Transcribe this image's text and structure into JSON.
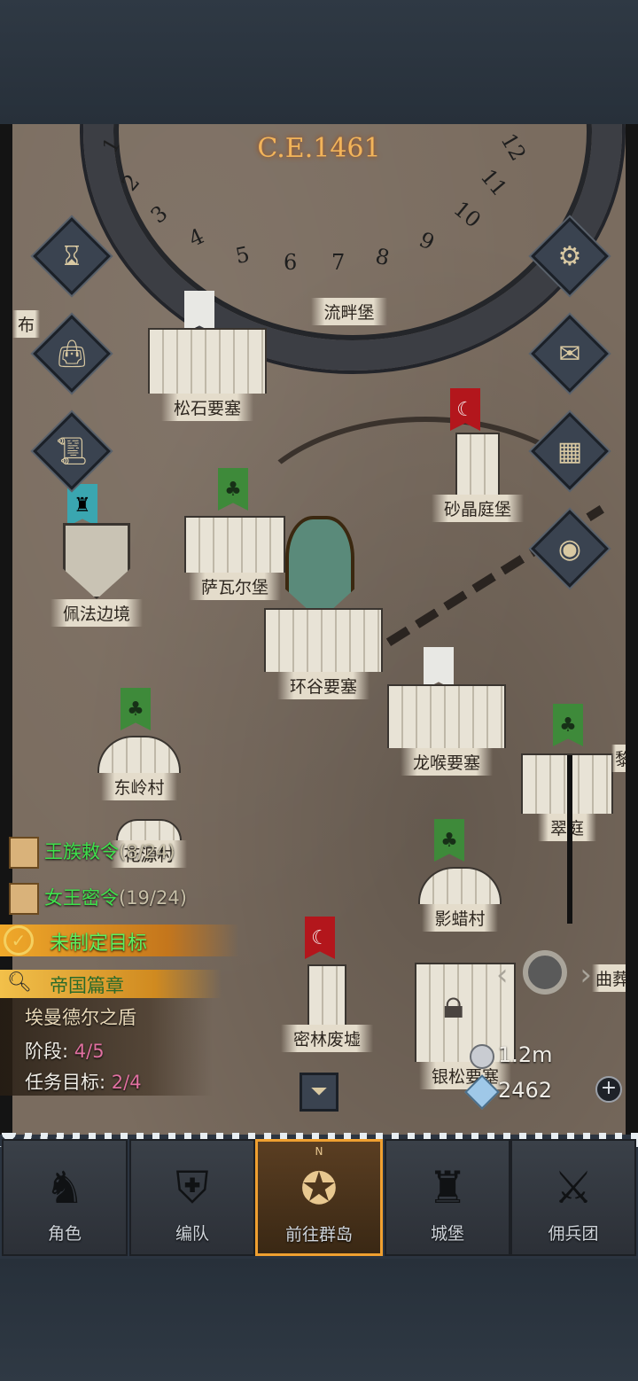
{
  "calendar": {
    "year": "C.E.1461",
    "months": [
      "1",
      "2",
      "3",
      "4",
      "5",
      "6",
      "7",
      "8",
      "9",
      "10",
      "11",
      "12"
    ]
  },
  "locations": {
    "liupan": "流畔堡",
    "songshi": "松石要塞",
    "shajing": "砂晶庭堡",
    "sawaer": "萨瓦尔堡",
    "peifa": "佩法边境",
    "huangu": "环谷要塞",
    "longhou": "龙喉要塞",
    "dongling": "东岭村",
    "huayuan": "花源村",
    "cuiting": "翠庭",
    "yingla": "影蜡村",
    "milin": "密林废墟",
    "yinsong": "银松要塞",
    "edge_left": "布",
    "edge_right": "曲葬",
    "edge_right2": "黎"
  },
  "quests": {
    "royal": {
      "title": "王族敕令",
      "count": "(8/24)"
    },
    "queen": {
      "title": "女王密令",
      "count": "(19/24)"
    },
    "goal": "未制定目标",
    "chapter": "帝国篇章",
    "chapter_name": "埃曼德尔之盾",
    "stage_label": "阶段:",
    "stage_value": "4/5",
    "target_label": "任务目标:",
    "target_value": "2/4"
  },
  "resources": {
    "silver": "1.2m",
    "gems": "2462"
  },
  "nav": {
    "tabs": [
      {
        "label": "角色",
        "icon": "knight-icon"
      },
      {
        "label": "编队",
        "icon": "formation-icon"
      },
      {
        "label": "前往群岛",
        "icon": "compass-icon"
      },
      {
        "label": "城堡",
        "icon": "castle-icon"
      },
      {
        "label": "佣兵团",
        "icon": "mercenary-icon"
      }
    ],
    "compass_north": "N"
  },
  "colors": {
    "accent": "#f0a030",
    "quest_green": "#3fe04c",
    "banner_red": "#b3161c",
    "banner_green": "#3e8a3a"
  }
}
